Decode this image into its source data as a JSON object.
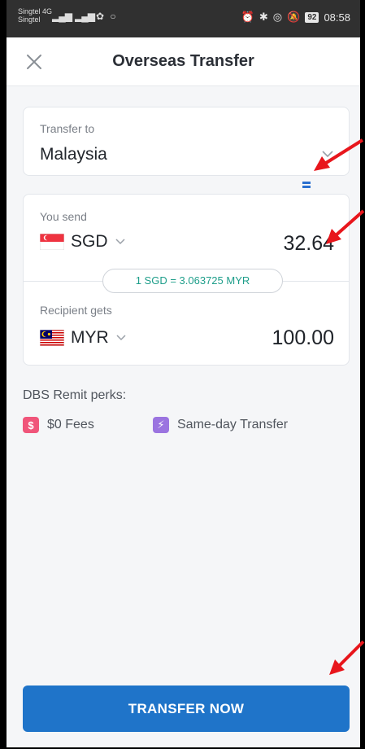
{
  "status_bar": {
    "carrier_1": "Singtel 4G",
    "carrier_2": "Singtel",
    "battery": "92",
    "time": "08:58"
  },
  "header": {
    "title": "Overseas Transfer",
    "close_icon": "close-icon"
  },
  "transfer_to": {
    "label": "Transfer to",
    "value": "Malaysia"
  },
  "send": {
    "label": "You send",
    "currency": "SGD",
    "amount": "32.64",
    "flag": "singapore-flag-icon"
  },
  "rate": {
    "text": "1 SGD = 3.063725 MYR"
  },
  "receive": {
    "label": "Recipient gets",
    "currency": "MYR",
    "amount": "100.00",
    "flag": "malaysia-flag-icon"
  },
  "perks": {
    "title": "DBS Remit perks:",
    "items": [
      {
        "badge": "$",
        "label": "$0 Fees",
        "color": "#f0557a"
      },
      {
        "badge": "⚡",
        "label": "Same-day Transfer",
        "color": "#9b74e0"
      }
    ]
  },
  "cta": {
    "label": "TRANSFER NOW"
  },
  "colors": {
    "primary": "#1f74c9",
    "rate_text": "#1e9e8a",
    "annotation_arrow": "#e8161c"
  }
}
